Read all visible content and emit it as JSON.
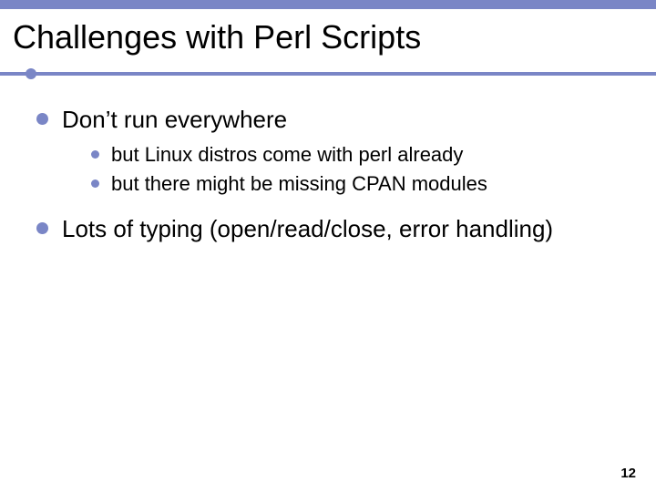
{
  "title": "Challenges with Perl Scripts",
  "bullets": {
    "item1": "Don’t run everywhere",
    "item1_sub1": "but Linux distros come with perl already",
    "item1_sub2": "but there might be missing CPAN modules",
    "item2": "Lots of typing (open/read/close, error handling)"
  },
  "page_number": "12"
}
